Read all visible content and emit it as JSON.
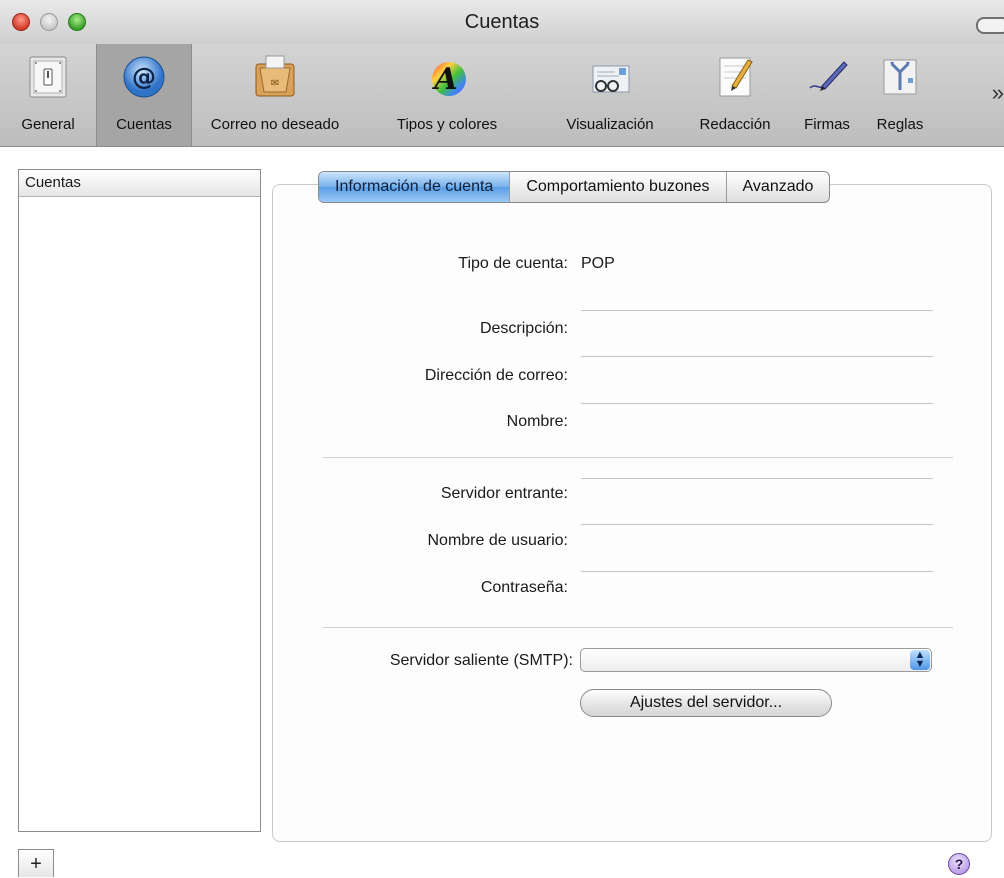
{
  "window": {
    "title": "Cuentas"
  },
  "toolbar": {
    "items": [
      {
        "label": "General",
        "icon": "switch-icon"
      },
      {
        "label": "Cuentas",
        "icon": "at-sign-icon"
      },
      {
        "label": "Correo no deseado",
        "icon": "junk-mail-icon"
      },
      {
        "label": "Tipos y colores",
        "icon": "font-color-icon"
      },
      {
        "label": "Visualización",
        "icon": "viewing-glasses-icon"
      },
      {
        "label": "Redacción",
        "icon": "compose-pencil-icon"
      },
      {
        "label": "Firmas",
        "icon": "signature-pen-icon"
      },
      {
        "label": "Reglas",
        "icon": "rules-arrows-icon"
      }
    ],
    "selected": "Cuentas",
    "overflow": "»"
  },
  "accounts": {
    "header": "Cuentas",
    "add_label": "+"
  },
  "tabs": [
    {
      "label": "Información de cuenta",
      "active": true
    },
    {
      "label": "Comportamiento buzones",
      "active": false
    },
    {
      "label": "Avanzado",
      "active": false
    }
  ],
  "form": {
    "account_type_label": "Tipo de cuenta:",
    "account_type_value": "POP",
    "description_label": "Descripción:",
    "description_value": "",
    "email_label": "Dirección de correo:",
    "email_value": "",
    "name_label": "Nombre:",
    "name_value": "",
    "incoming_label": "Servidor entrante:",
    "incoming_value": "",
    "username_label": "Nombre de usuario:",
    "username_value": "",
    "password_label": "Contraseña:",
    "password_value": "",
    "smtp_label": "Servidor saliente (SMTP):",
    "smtp_value": "",
    "server_settings_button": "Ajustes del servidor..."
  },
  "help": {
    "label": "?"
  },
  "colors": {
    "accent": "#5a9ee6",
    "toolbar": "#c9c9c9",
    "selected_tab": "#76b1ec"
  }
}
